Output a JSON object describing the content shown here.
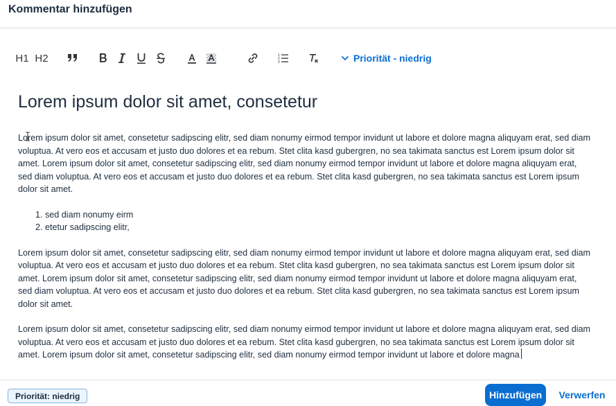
{
  "dialog": {
    "title": "Kommentar hinzufügen"
  },
  "toolbar": {
    "h1_label": "H1",
    "h2_label": "H2",
    "priority_label": "Priorität - niedrig"
  },
  "editor": {
    "heading": "Lorem ipsum dolor sit amet, consetetur",
    "paragraphs": [
      "Lorem ipsum dolor sit amet, consetetur sadipscing elitr, sed diam nonumy eirmod tempor invidunt ut labore et dolore magna aliquyam erat, sed diam voluptua. At vero eos et accusam et justo duo dolores et ea rebum. Stet clita kasd gubergren, no sea takimata sanctus est Lorem ipsum dolor sit amet. Lorem ipsum dolor sit amet, consetetur sadipscing elitr, sed diam nonumy eirmod tempor invidunt ut labore et dolore magna aliquyam erat, sed diam voluptua. At vero eos et accusam et justo duo dolores et ea rebum. Stet clita kasd gubergren, no sea takimata sanctus est Lorem ipsum dolor sit amet.",
      "Lorem ipsum dolor sit amet, consetetur sadipscing elitr, sed diam nonumy eirmod tempor invidunt ut labore et dolore magna aliquyam erat, sed diam voluptua. At vero eos et accusam et justo duo dolores et ea rebum. Stet clita kasd gubergren, no sea takimata sanctus est Lorem ipsum dolor sit amet. Lorem ipsum dolor sit amet, consetetur sadipscing elitr, sed diam nonumy eirmod tempor invidunt ut labore et dolore magna aliquyam erat, sed diam voluptua. At vero eos et accusam et justo duo dolores et ea rebum. Stet clita kasd gubergren, no sea takimata sanctus est Lorem ipsum dolor sit amet.",
      "Lorem ipsum dolor sit amet, consetetur sadipscing elitr, sed diam nonumy eirmod tempor invidunt ut labore et dolore magna aliquyam erat, sed diam voluptua. At vero eos et accusam et justo duo dolores et ea rebum. Stet clita kasd gubergren, no sea takimata sanctus est Lorem ipsum dolor sit amet. Lorem ipsum dolor sit amet, consetetur sadipscing elitr, sed diam nonumy eirmod tempor invidunt ut labore et dolore magna"
    ],
    "list_items": [
      "sed diam nonumy eirm",
      "etetur sadipscing elitr,"
    ]
  },
  "footer": {
    "badge_label": "Priorität: niedrig",
    "add_label": "Hinzufügen",
    "discard_label": "Verwerfen"
  },
  "icons": {
    "heading1": "heading-1-icon",
    "heading2": "heading-2-icon",
    "quote": "quote-icon",
    "bold": "bold-icon",
    "italic": "italic-icon",
    "underline": "underline-icon",
    "strikethrough": "strikethrough-icon",
    "text_color": "text-color-icon",
    "highlight": "highlight-icon",
    "link": "link-icon",
    "ordered_list": "ordered-list-icon",
    "clear_format": "clear-format-icon",
    "chevron": "chevron-down-icon"
  },
  "colors": {
    "accent": "#0a6ed1",
    "text": "#1d2d3e",
    "badge_bg": "#ebf5fe",
    "badge_border": "#89b3d8"
  }
}
